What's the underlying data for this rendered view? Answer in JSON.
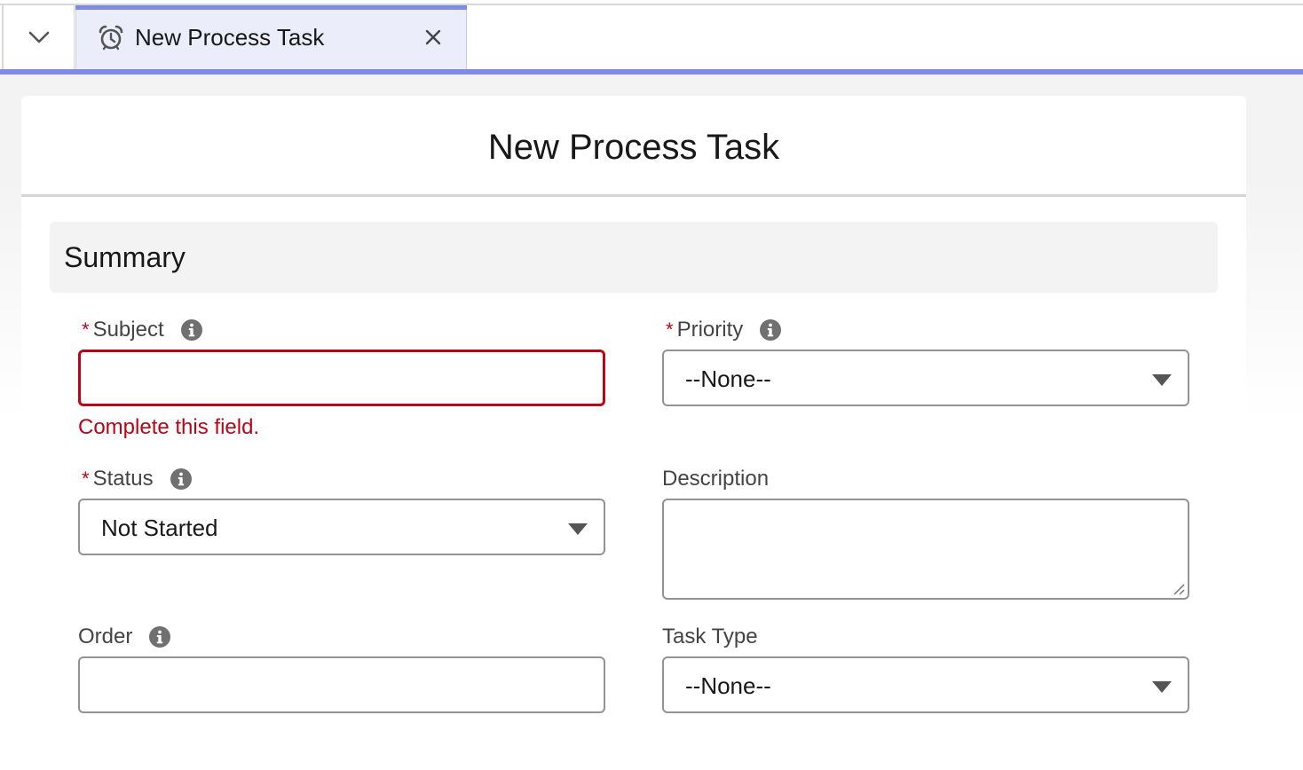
{
  "tabs": [
    {
      "label": "New Process Task",
      "icon": "alarm-clock-icon",
      "active": true
    }
  ],
  "nav": {
    "toggle_icon": "chevron-down-icon"
  },
  "modal": {
    "title": "New Process Task",
    "section_title": "Summary"
  },
  "fields": {
    "subject": {
      "label": "Subject",
      "required_mark": "*",
      "value": "",
      "error": "Complete this field."
    },
    "priority": {
      "label": "Priority",
      "required_mark": "*",
      "value": "--None--"
    },
    "status": {
      "label": "Status",
      "required_mark": "*",
      "value": "Not Started"
    },
    "description": {
      "label": "Description",
      "value": ""
    },
    "order": {
      "label": "Order",
      "value": ""
    },
    "task_type": {
      "label": "Task Type",
      "value": "--None--"
    }
  },
  "colors": {
    "accent": "#7e8be4",
    "tab_bg": "#ecedfa",
    "error": "#ba0517",
    "section_bg": "#f3f3f3"
  }
}
